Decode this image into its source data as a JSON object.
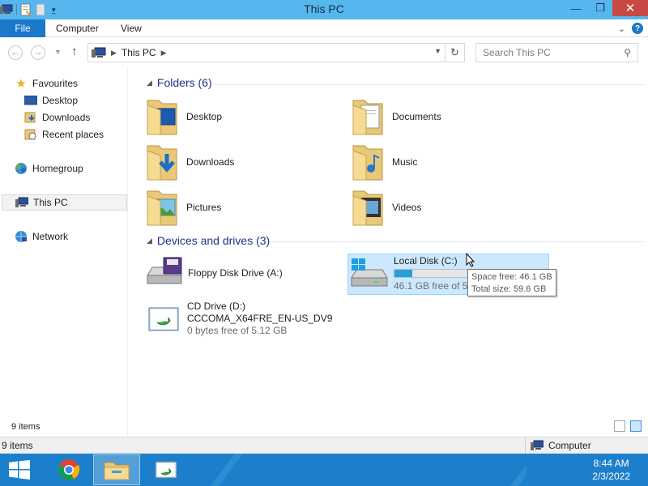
{
  "window": {
    "title": "This PC"
  },
  "ribbon": {
    "tabs": [
      "File",
      "Computer",
      "View"
    ]
  },
  "address": {
    "path": "This PC",
    "search_placeholder": "Search This PC"
  },
  "nav": {
    "favourites": "Favourites",
    "fav_items": [
      "Desktop",
      "Downloads",
      "Recent places"
    ],
    "homegroup": "Homegroup",
    "this_pc": "This PC",
    "network": "Network"
  },
  "folders": {
    "header": "Folders (6)",
    "items": [
      "Desktop",
      "Documents",
      "Downloads",
      "Music",
      "Pictures",
      "Videos"
    ]
  },
  "devices": {
    "header": "Devices and drives (3)",
    "floppy": {
      "name": "Floppy Disk Drive (A:)"
    },
    "local": {
      "name": "Local Disk (C:)",
      "free": "46.1 GB free of 59",
      "used_fraction": 0.23
    },
    "cd": {
      "name": "CD Drive (D:)",
      "label": "CCCOMA_X64FRE_EN-US_DV9",
      "free": "0 bytes free of 5.12 GB"
    }
  },
  "tooltip": {
    "line1": "Space free: 46.1 GB",
    "line2": "Total size: 59.6 GB"
  },
  "status": {
    "items": "9 items",
    "items2": "9 items",
    "zone": "Computer"
  },
  "taskbar": {
    "time": "8:44 AM",
    "date": "2/3/2022"
  },
  "colors": {
    "titlebar": "#55b7ee",
    "file_tab": "#1979ca",
    "taskbar": "#1c7fcc",
    "selection": "#cce8ff",
    "capacity": "#26a0da"
  }
}
